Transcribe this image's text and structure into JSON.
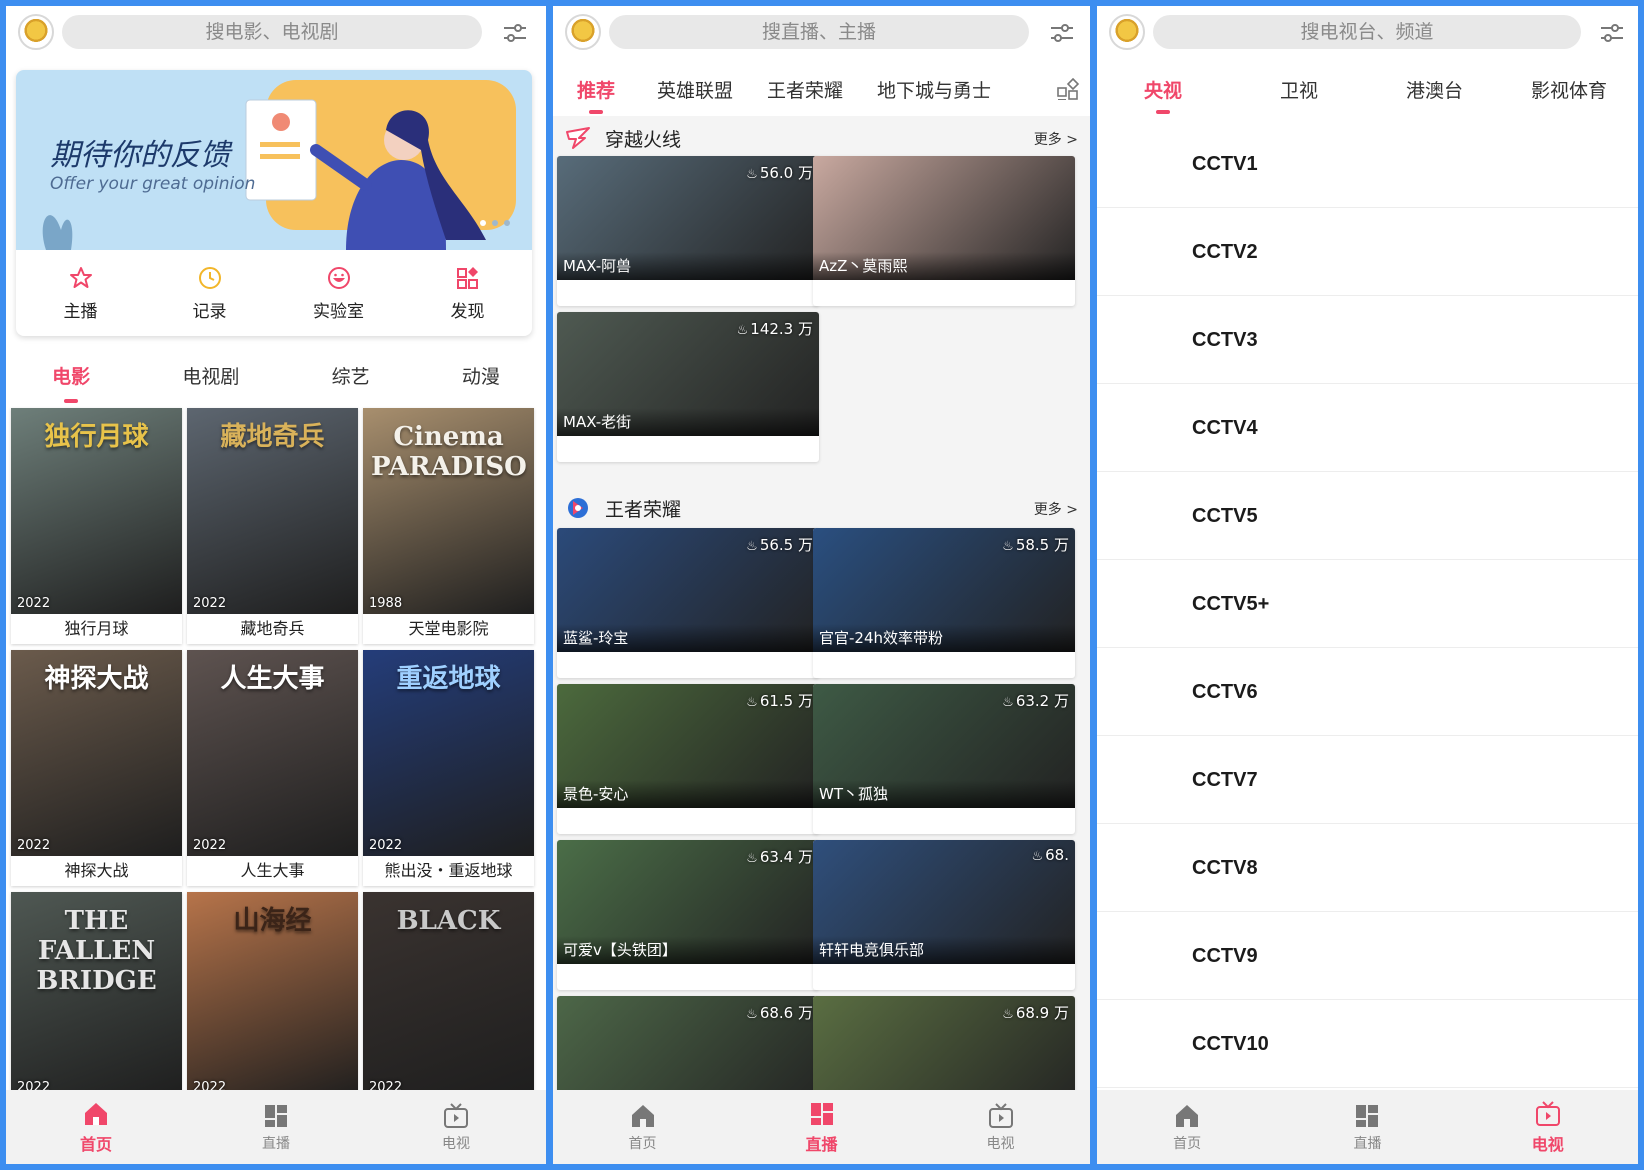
{
  "colors": {
    "accent": "#f0476a",
    "frame": "#3d8ef0",
    "nav_bg": "#f2f2f2",
    "inactive": "#888888"
  },
  "bottom_nav": [
    {
      "label": "首页",
      "icon": "home-icon"
    },
    {
      "label": "直播",
      "icon": "grid-icon"
    },
    {
      "label": "电视",
      "icon": "tv-icon"
    }
  ],
  "home": {
    "search_placeholder": "搜电影、电视剧",
    "banner": {
      "title": "期待你的反馈",
      "subtitle": "Offer your great opinion",
      "pages": 3,
      "active_page": 1
    },
    "quick": [
      {
        "label": "主播",
        "icon": "star-icon"
      },
      {
        "label": "记录",
        "icon": "clock-icon"
      },
      {
        "label": "实验室",
        "icon": "smile-icon"
      },
      {
        "label": "发现",
        "icon": "discover-icon"
      }
    ],
    "tabs": [
      "电影",
      "电视剧",
      "综艺",
      "动漫"
    ],
    "active_tab": 0,
    "movies": [
      {
        "title": "独行月球",
        "year": "2022",
        "poster_text": "独行月球",
        "bg": "#6e7f7a",
        "color": "#e8c34a"
      },
      {
        "title": "藏地奇兵",
        "year": "2022",
        "poster_text": "藏地奇兵",
        "bg": "#5d6670",
        "color": "#d9b25a"
      },
      {
        "title": "天堂电影院",
        "year": "1988",
        "poster_text": "Cinema PARADISO",
        "bg": "#a88f6e",
        "color": "#f4f1ea"
      },
      {
        "title": "神探大战",
        "year": "2022",
        "poster_text": "神探大战",
        "bg": "#6b5b4c",
        "color": "#ffffff"
      },
      {
        "title": "人生大事",
        "year": "2022",
        "poster_text": "人生大事",
        "bg": "#5e5350",
        "color": "#ffffff"
      },
      {
        "title": "熊出没・重返地球",
        "year": "2022",
        "poster_text": "重返地球",
        "bg": "#243d7a",
        "color": "#9fd0ff"
      },
      {
        "title": "",
        "year": "2022",
        "poster_text": "THE FALLEN BRIDGE",
        "bg": "#4f5853",
        "color": "#e6e6e6"
      },
      {
        "title": "",
        "year": "2022",
        "poster_text": "山海经",
        "bg": "#b7744a",
        "color": "#3b2418"
      },
      {
        "title": "",
        "year": "2022",
        "poster_text": "BLACK",
        "bg": "#3a3330",
        "color": "#c9c9c9"
      }
    ]
  },
  "live": {
    "search_placeholder": "搜直播、主播",
    "categories": [
      "推荐",
      "英雄联盟",
      "王者荣耀",
      "地下城与勇士"
    ],
    "active_category": 0,
    "sections": [
      {
        "title": "穿越火线",
        "more": "更多 >",
        "streams": [
          {
            "host": "MAX-阿兽",
            "hot": "56.0 万",
            "bg": "#586c7a"
          },
          {
            "host": "AzZ丶莫雨熙",
            "hot": "",
            "bg": "#c9a9a0"
          },
          {
            "host": "MAX-老街",
            "hot": "142.3 万",
            "bg": "#4f5a52"
          }
        ]
      },
      {
        "title": "王者荣耀",
        "more": "更多 >",
        "streams": [
          {
            "host": "蓝鲨-玲宝",
            "hot": "56.5 万",
            "bg": "#2b4a7a"
          },
          {
            "host": "官官-24h效率带粉",
            "hot": "58.5 万",
            "bg": "#2a4f80"
          },
          {
            "host": "景色-安心",
            "hot": "61.5 万",
            "bg": "#4c6a3d"
          },
          {
            "host": "WT丶孤独",
            "hot": "63.2 万",
            "bg": "#3e5a45"
          },
          {
            "host": "可爱v【头铁团】",
            "hot": "63.4 万",
            "bg": "#4b6e48"
          },
          {
            "host": "轩轩电竞俱乐部",
            "hot": "68.",
            "bg": "#2f4f7c"
          },
          {
            "host": "",
            "hot": "68.6 万",
            "bg": "#4d6748"
          },
          {
            "host": "",
            "hot": "68.9 万",
            "bg": "#5a6e42"
          }
        ]
      }
    ]
  },
  "tv": {
    "search_placeholder": "搜电视台、频道",
    "tabs": [
      "央视",
      "卫视",
      "港澳台",
      "影视体育"
    ],
    "active_tab": 0,
    "channels": [
      "CCTV1",
      "CCTV2",
      "CCTV3",
      "CCTV4",
      "CCTV5",
      "CCTV5+",
      "CCTV6",
      "CCTV7",
      "CCTV8",
      "CCTV9",
      "CCTV10"
    ]
  }
}
